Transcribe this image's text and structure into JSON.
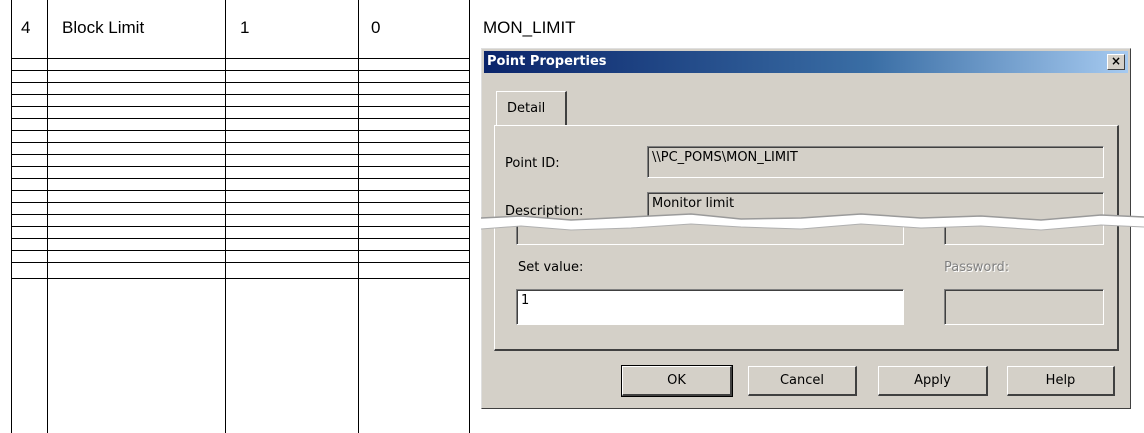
{
  "table": {
    "row": {
      "num": "4",
      "name": "Block Limit",
      "val1": "1",
      "val2": "0"
    }
  },
  "point_label": "MON_LIMIT",
  "dialog": {
    "title": "Point Properties",
    "close_glyph": "×",
    "tab": "Detail",
    "point_id_label": "Point ID:",
    "point_id_value": "\\\\PC_POMS\\MON_LIMIT",
    "description_label": "Description:",
    "description_value": "Monitor limit",
    "set_value_label": "Set value:",
    "set_value": "1",
    "password_label": "Password:",
    "buttons": {
      "ok": "OK",
      "cancel": "Cancel",
      "apply": "Apply",
      "help": "Help"
    }
  }
}
